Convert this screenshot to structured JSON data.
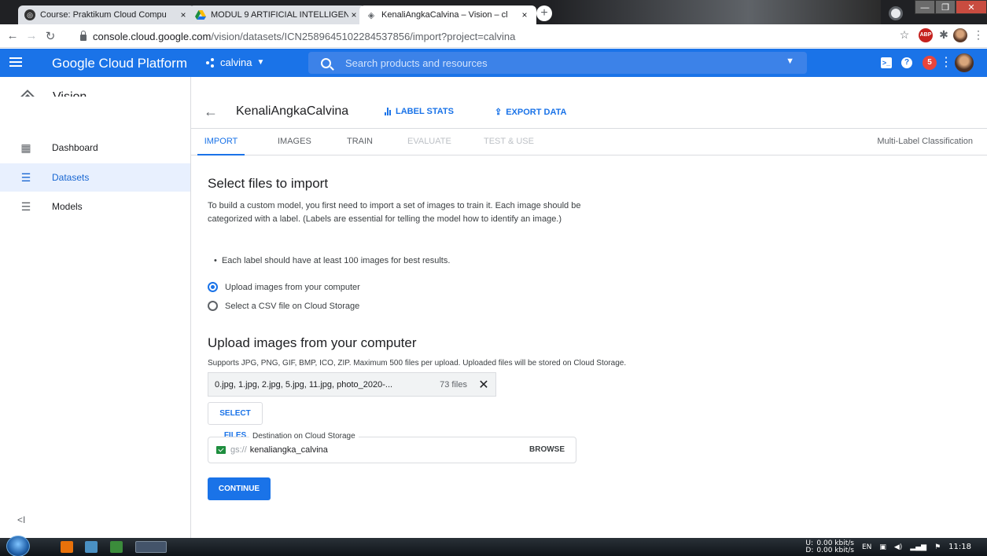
{
  "browser": {
    "tabs": [
      {
        "title": "Course: Praktikum Cloud Compu",
        "close": "×"
      },
      {
        "title": "MODUL 9 ARTIFICIAL INTELLIGEN",
        "close": "×"
      },
      {
        "title": "KenaliAngkaCalvina – Vision – cl",
        "close": "×"
      }
    ],
    "new_tab": "+",
    "url_host": "console.cloud.google.com",
    "url_path": "/vision/datasets/ICN2589645102284537856/import?project=calvina"
  },
  "gcp": {
    "brand": "Google Cloud Platform",
    "project": "calvina",
    "search_placeholder": "Search products and resources",
    "notifications": "5"
  },
  "sidebar": {
    "product": "Vision",
    "items": [
      {
        "label": "Dashboard"
      },
      {
        "label": "Datasets"
      },
      {
        "label": "Models"
      }
    ],
    "collapse": "<I"
  },
  "dataset": {
    "name": "KenaliAngkaCalvina",
    "label_stats": "LABEL STATS",
    "export_data": "EXPORT DATA"
  },
  "tabs": {
    "import": "IMPORT",
    "images": "IMAGES",
    "train": "TRAIN",
    "evaluate": "EVALUATE",
    "test_use": "TEST & USE",
    "model_type": "Multi-Label Classification"
  },
  "import": {
    "title": "Select files to import",
    "description": "To build a custom model, you first need to import a set of images to train it. Each image should be categorized with a label. (Labels are essential for telling the model how to identify an image.)",
    "tip": "Each label should have at least 100 images for best results.",
    "option_upload": "Upload images from your computer",
    "option_csv": "Select a CSV file on Cloud Storage",
    "upload_title": "Upload images from your computer",
    "upload_help": "Supports JPG, PNG, GIF, BMP, ICO, ZIP. Maximum 500 files per upload. Uploaded files will be stored on Cloud Storage.",
    "file_names": "0.jpg, 1.jpg, 2.jpg, 5.jpg, 11.jpg, photo_2020-...",
    "file_count": "73 files",
    "select_files": "SELECT FILES",
    "destination_label": "Destination on Cloud Storage",
    "destination_prefix": "gs://",
    "destination_bucket": "kenaliangka_calvina",
    "browse": "BROWSE",
    "continue": "CONTINUE"
  },
  "taskbar": {
    "net_up_label": "U:",
    "net_down_label": "D:",
    "net_up": "0.00 kbit/s",
    "net_down": "0.00 kbit/s",
    "lang": "EN",
    "time": "11:18"
  }
}
